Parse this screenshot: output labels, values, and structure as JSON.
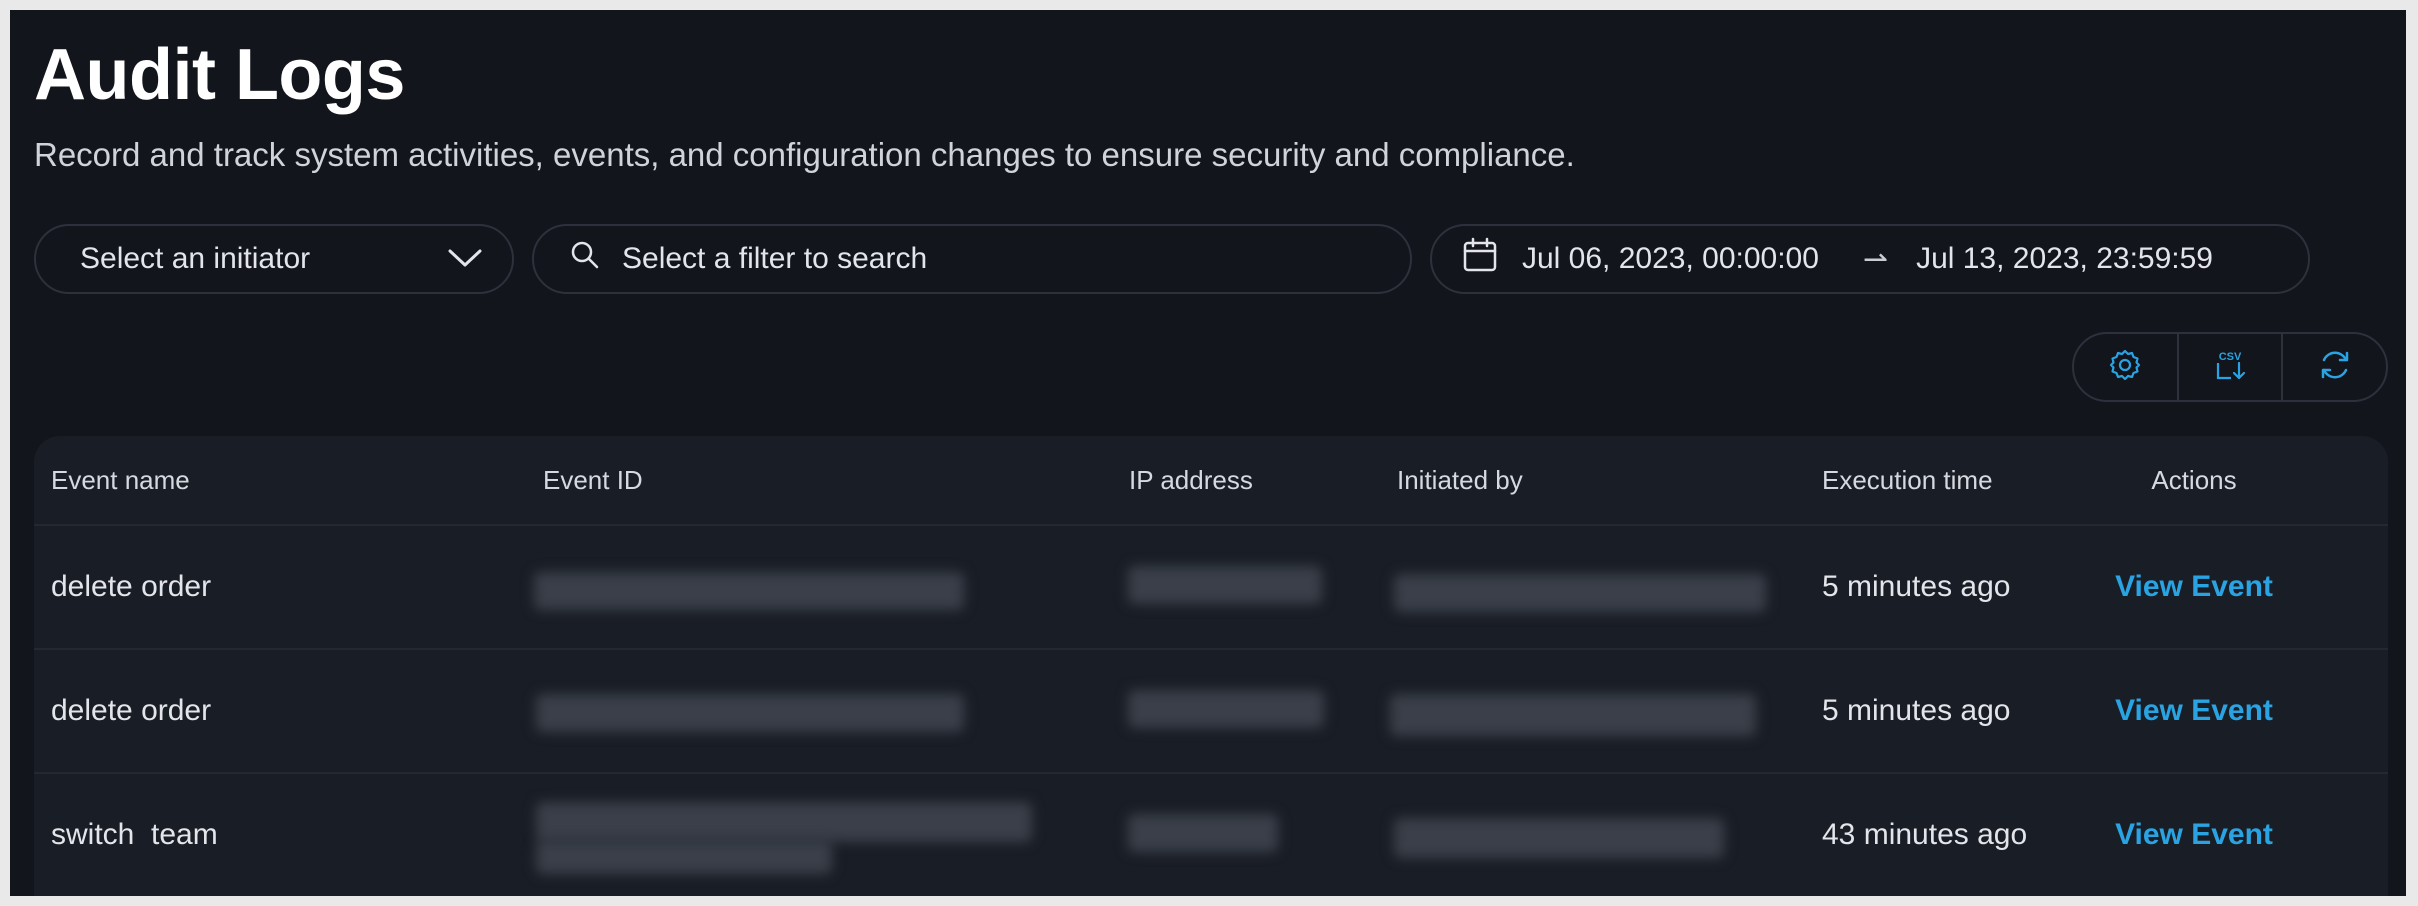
{
  "page": {
    "title": "Audit Logs",
    "subtitle": "Record and track system activities, events, and configuration changes to ensure security and compliance."
  },
  "filters": {
    "initiator_placeholder": "Select an initiator",
    "search_placeholder": "Select a filter to search",
    "date_start": "Jul 06, 2023, 00:00:00",
    "date_separator": "⇀",
    "date_end": "Jul 13, 2023, 23:59:59"
  },
  "toolbar": {
    "icons": [
      "gear-icon",
      "csv-download-icon",
      "refresh-icon"
    ],
    "csv_icon_text": "CSV"
  },
  "table": {
    "columns": [
      "Event name",
      "Event ID",
      "IP address",
      "Initiated by",
      "Execution time",
      "Actions"
    ],
    "rows": [
      {
        "event_name": "delete order",
        "execution_time": "5 minutes ago",
        "action": "View Event"
      },
      {
        "event_name": "delete order",
        "execution_time": "5 minutes ago",
        "action": "View Event"
      },
      {
        "event_name": "switch  team",
        "execution_time": "43 minutes ago",
        "action": "View Event"
      }
    ]
  },
  "colors": {
    "background": "#12151c",
    "table_background": "#191d25",
    "border": "#2c313c",
    "accent": "#2aa3e2",
    "text": "#e3e5ea"
  }
}
